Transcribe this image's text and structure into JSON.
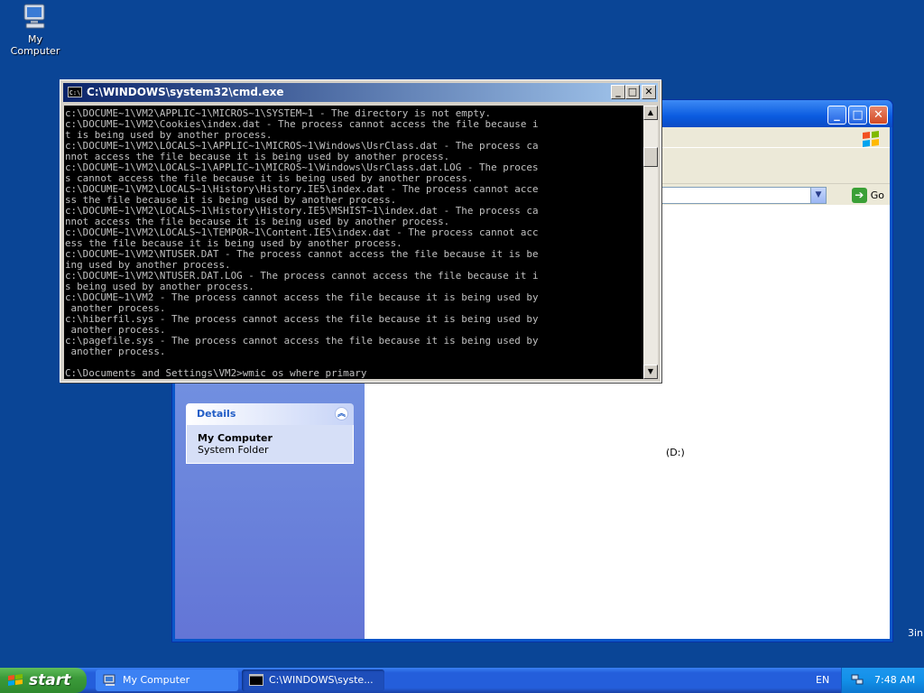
{
  "desktop": {
    "icons": [
      {
        "label": "My Computer",
        "icon": "my-computer-icon"
      }
    ]
  },
  "explorer": {
    "go_label": "Go",
    "details_panel": {
      "title": "Details",
      "item_name": "My Computer",
      "item_type": "System Folder"
    },
    "drive_label_fragment": "(D:)",
    "side_fragment": "3in"
  },
  "cmd": {
    "title": "C:\\WINDOWS\\system32\\cmd.exe",
    "icon_text": "C:\\",
    "lines": [
      "c:\\DOCUME~1\\VM2\\APPLIC~1\\MICROS~1\\SYSTEM~1 - The directory is not empty.",
      "c:\\DOCUME~1\\VM2\\Cookies\\index.dat - The process cannot access the file because i",
      "t is being used by another process.",
      "c:\\DOCUME~1\\VM2\\LOCALS~1\\APPLIC~1\\MICROS~1\\Windows\\UsrClass.dat - The process ca",
      "nnot access the file because it is being used by another process.",
      "c:\\DOCUME~1\\VM2\\LOCALS~1\\APPLIC~1\\MICROS~1\\Windows\\UsrClass.dat.LOG - The proces",
      "s cannot access the file because it is being used by another process.",
      "c:\\DOCUME~1\\VM2\\LOCALS~1\\History\\History.IE5\\index.dat - The process cannot acce",
      "ss the file because it is being used by another process.",
      "c:\\DOCUME~1\\VM2\\LOCALS~1\\History\\History.IE5\\MSHIST~1\\index.dat - The process ca",
      "nnot access the file because it is being used by another process.",
      "c:\\DOCUME~1\\VM2\\LOCALS~1\\TEMPOR~1\\Content.IE5\\index.dat - The process cannot acc",
      "ess the file because it is being used by another process.",
      "c:\\DOCUME~1\\VM2\\NTUSER.DAT - The process cannot access the file because it is be",
      "ing used by another process.",
      "c:\\DOCUME~1\\VM2\\NTUSER.DAT.LOG - The process cannot access the file because it i",
      "s being used by another process.",
      "c:\\DOCUME~1\\VM2 - The process cannot access the file because it is being used by",
      " another process.",
      "c:\\hiberfil.sys - The process cannot access the file because it is being used by",
      " another process.",
      "c:\\pagefile.sys - The process cannot access the file because it is being used by",
      " another process.",
      "",
      "C:\\Documents and Settings\\VM2>wmic os where primary"
    ]
  },
  "taskbar": {
    "start_label": "start",
    "buttons": [
      {
        "label": "My Computer",
        "icon": "my-computer-icon"
      },
      {
        "label": "C:\\WINDOWS\\syste...",
        "icon": "cmd-icon"
      }
    ],
    "language": "EN",
    "clock": "7:48 AM"
  },
  "colors": {
    "desktop": "#0a4596",
    "taskbar": "#245edb",
    "start": "#3c9a3a",
    "console_bg": "#000000",
    "console_fg": "#c0c0c0"
  }
}
